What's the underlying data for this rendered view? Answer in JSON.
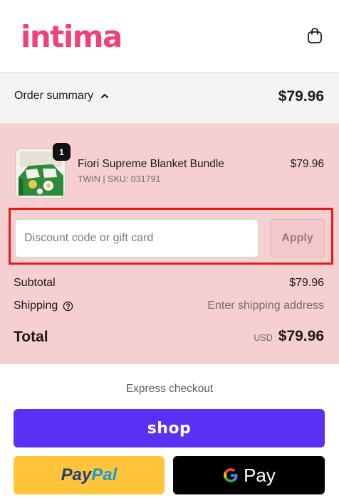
{
  "header": {
    "logo_text": "intima",
    "cart_icon": "shopping-bag-icon"
  },
  "summary_bar": {
    "toggle_label": "Order summary",
    "toggle_icon": "chevron-up-icon",
    "total": "$79.96"
  },
  "product": {
    "quantity": "1",
    "name": "Fiori Supreme Blanket Bundle",
    "variant": "TWIN | SKU: 031791",
    "price": "$79.96"
  },
  "discount": {
    "placeholder": "Discount code or gift card",
    "value": "",
    "apply_label": "Apply"
  },
  "lines": {
    "subtotal_label": "Subtotal",
    "subtotal_value": "$79.96",
    "shipping_label": "Shipping",
    "shipping_value": "Enter shipping address",
    "help_icon": "question-circle-icon"
  },
  "total": {
    "label": "Total",
    "currency": "USD",
    "value": "$79.96"
  },
  "express": {
    "label": "Express checkout",
    "shop_label": "shop",
    "paypal_part1": "Pay",
    "paypal_part2": "Pal",
    "gpay_label": "Pay"
  },
  "colors": {
    "brand_pink": "#f0427a",
    "summary_panel": "#f6cfd1",
    "shop_purple": "#5a31f4",
    "paypal_yellow": "#ffc439",
    "highlight_red": "#e41b1b"
  }
}
